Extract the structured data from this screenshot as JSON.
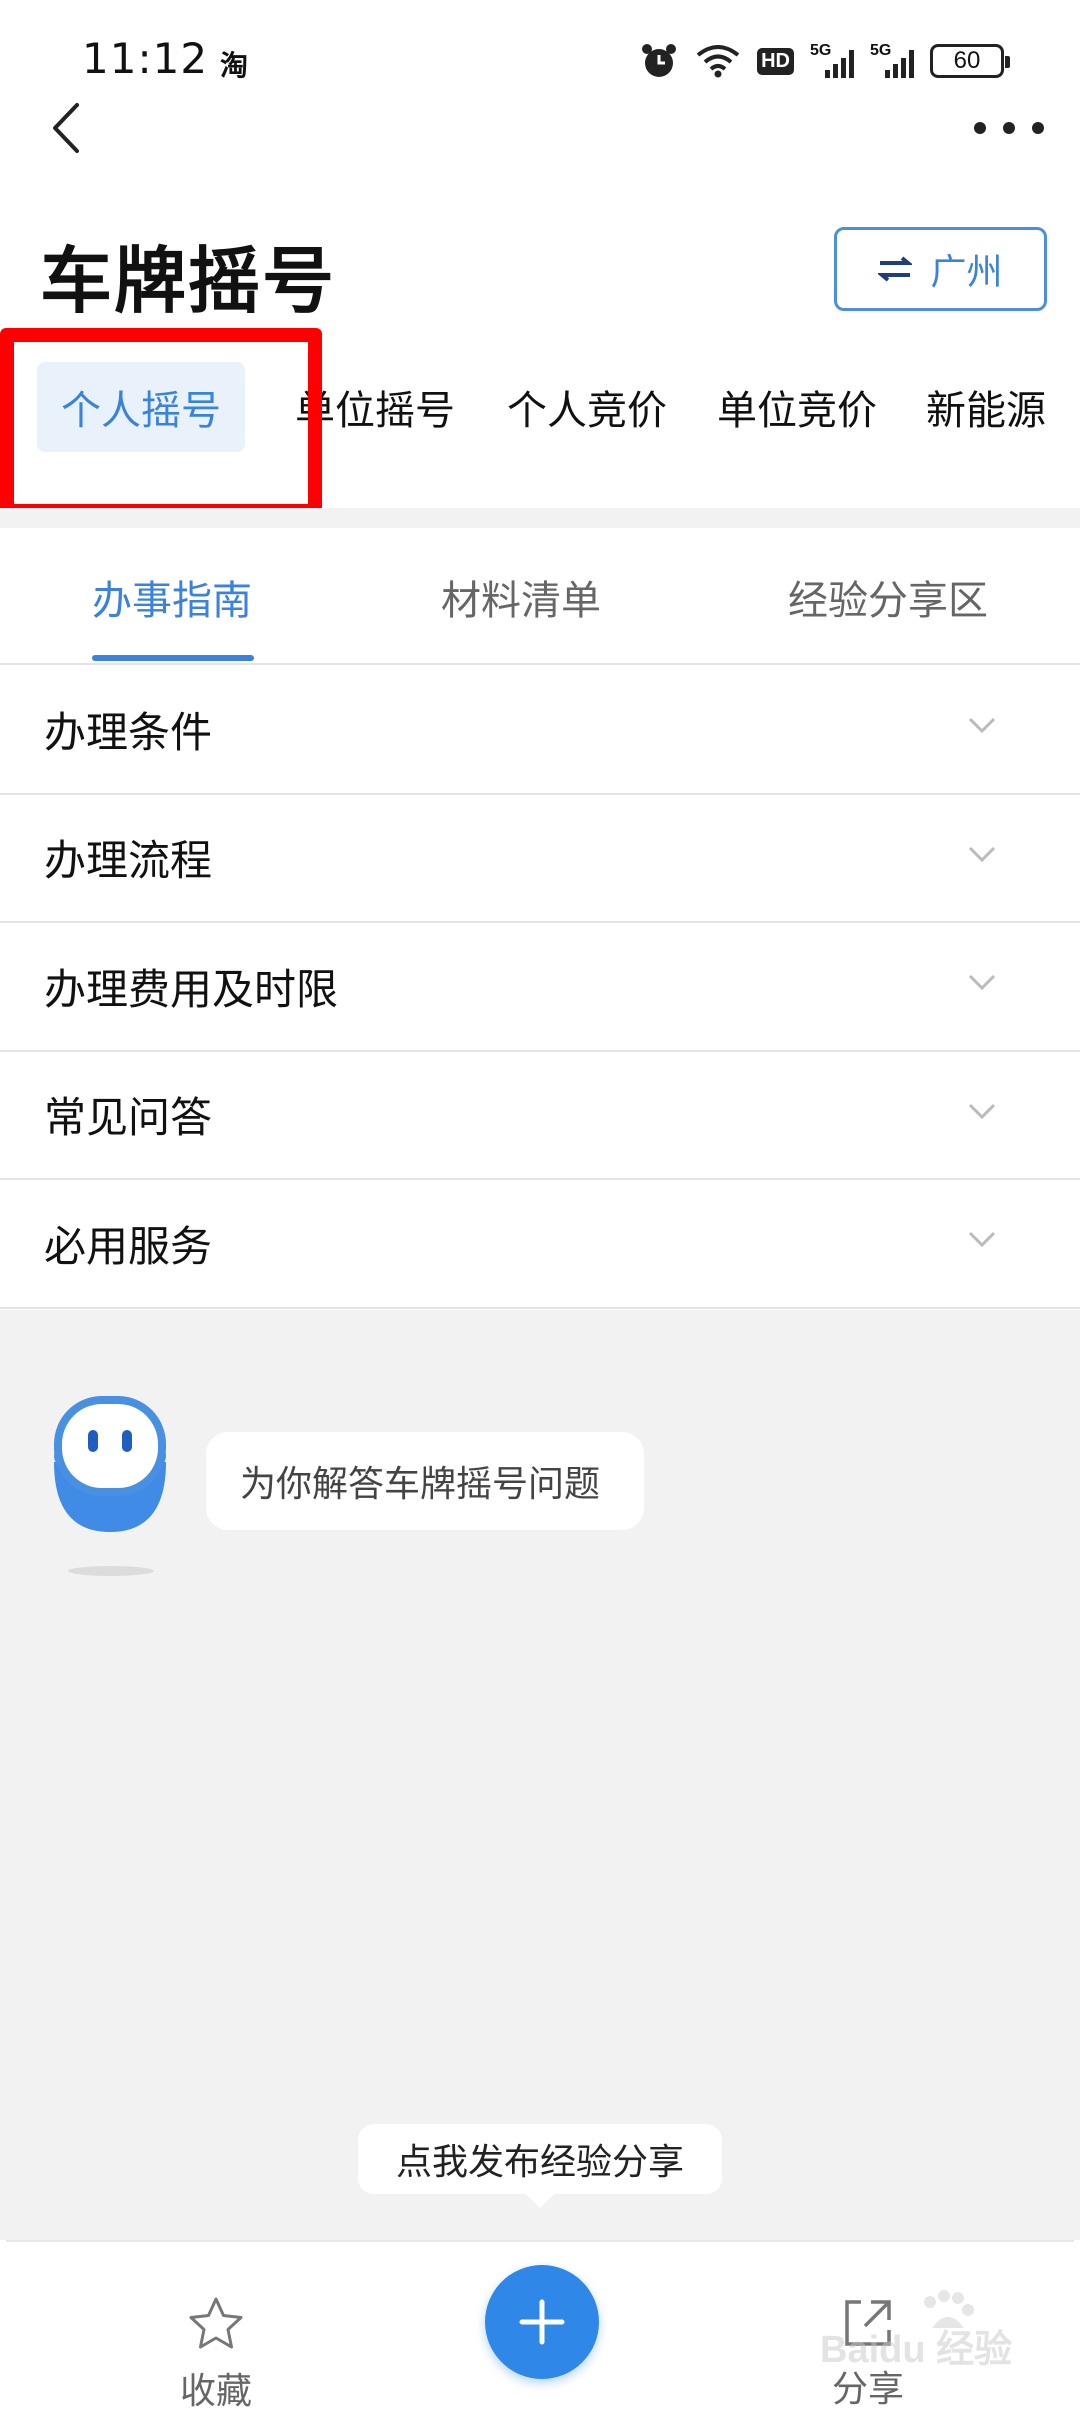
{
  "status_bar": {
    "time": "11:12",
    "app_glyph": "淘",
    "hd_badge": "HD",
    "signal_labels": [
      "5G",
      "5G"
    ],
    "battery": "60",
    "icons": [
      "alarm-icon",
      "wifi-icon",
      "hd-icon",
      "signal-5g-icon",
      "signal-5g-icon",
      "battery-icon"
    ]
  },
  "nav": {
    "back_icon": "chevron-left-icon",
    "more_icon": "more-dots-icon"
  },
  "page": {
    "title": "车牌摇号"
  },
  "city": {
    "label": "广州",
    "icon": "swap-icon",
    "accent": "#3a82db"
  },
  "category_tabs": [
    {
      "label": "个人摇号",
      "active": true
    },
    {
      "label": "单位摇号",
      "active": false
    },
    {
      "label": "个人竞价",
      "active": false
    },
    {
      "label": "单位竞价",
      "active": false
    },
    {
      "label": "新能源",
      "active": false
    }
  ],
  "sub_tabs": [
    {
      "label": "办事指南",
      "active": true
    },
    {
      "label": "材料清单",
      "active": false
    },
    {
      "label": "经验分享区",
      "active": false
    }
  ],
  "accordion": [
    {
      "label": "办理条件"
    },
    {
      "label": "办理流程"
    },
    {
      "label": "办理费用及时限"
    },
    {
      "label": "常见问答"
    },
    {
      "label": "必用服务"
    }
  ],
  "assistant": {
    "message": "为你解答车牌摇号问题",
    "avatar_icon": "robot-icon"
  },
  "publish_tip": "点我发布经验分享",
  "bottom_bar": {
    "favorite_label": "收藏",
    "share_label": "分享",
    "favorite_icon": "star-icon",
    "share_icon": "share-icon",
    "fab_icon": "plus-icon"
  },
  "watermark": "Baidu 经验",
  "colors": {
    "accent": "#3a82db",
    "highlight": "#ff0000",
    "fab": "#2f88e8",
    "background_gray": "#f2f2f2"
  }
}
